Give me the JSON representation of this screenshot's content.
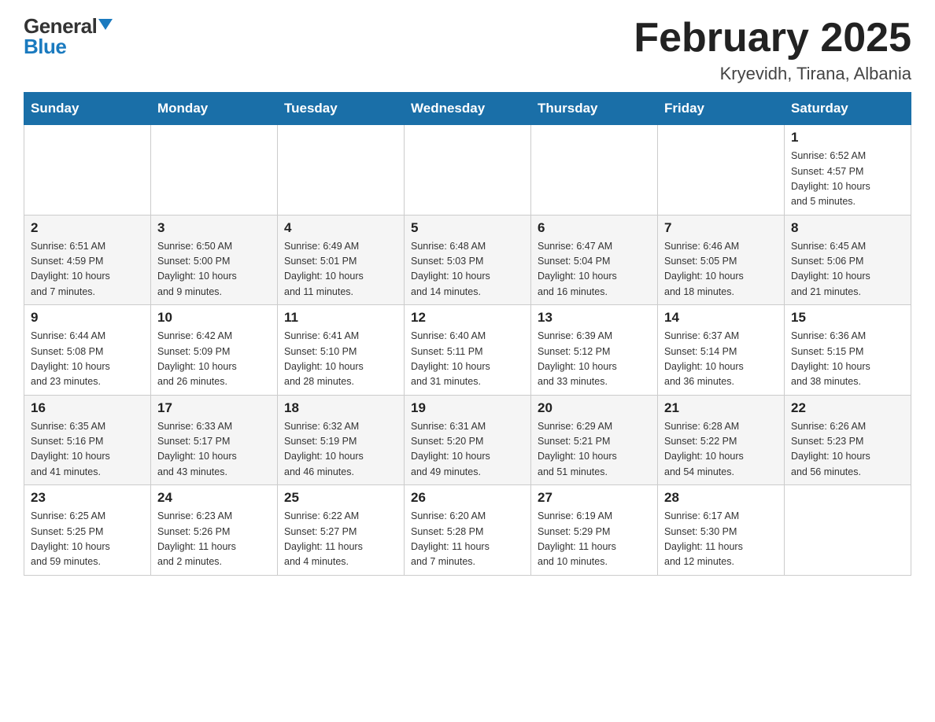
{
  "header": {
    "logo_general": "General",
    "logo_blue": "Blue",
    "title": "February 2025",
    "location": "Kryevidh, Tirana, Albania"
  },
  "weekdays": [
    "Sunday",
    "Monday",
    "Tuesday",
    "Wednesday",
    "Thursday",
    "Friday",
    "Saturday"
  ],
  "weeks": [
    [
      {
        "day": "",
        "info": ""
      },
      {
        "day": "",
        "info": ""
      },
      {
        "day": "",
        "info": ""
      },
      {
        "day": "",
        "info": ""
      },
      {
        "day": "",
        "info": ""
      },
      {
        "day": "",
        "info": ""
      },
      {
        "day": "1",
        "info": "Sunrise: 6:52 AM\nSunset: 4:57 PM\nDaylight: 10 hours\nand 5 minutes."
      }
    ],
    [
      {
        "day": "2",
        "info": "Sunrise: 6:51 AM\nSunset: 4:59 PM\nDaylight: 10 hours\nand 7 minutes."
      },
      {
        "day": "3",
        "info": "Sunrise: 6:50 AM\nSunset: 5:00 PM\nDaylight: 10 hours\nand 9 minutes."
      },
      {
        "day": "4",
        "info": "Sunrise: 6:49 AM\nSunset: 5:01 PM\nDaylight: 10 hours\nand 11 minutes."
      },
      {
        "day": "5",
        "info": "Sunrise: 6:48 AM\nSunset: 5:03 PM\nDaylight: 10 hours\nand 14 minutes."
      },
      {
        "day": "6",
        "info": "Sunrise: 6:47 AM\nSunset: 5:04 PM\nDaylight: 10 hours\nand 16 minutes."
      },
      {
        "day": "7",
        "info": "Sunrise: 6:46 AM\nSunset: 5:05 PM\nDaylight: 10 hours\nand 18 minutes."
      },
      {
        "day": "8",
        "info": "Sunrise: 6:45 AM\nSunset: 5:06 PM\nDaylight: 10 hours\nand 21 minutes."
      }
    ],
    [
      {
        "day": "9",
        "info": "Sunrise: 6:44 AM\nSunset: 5:08 PM\nDaylight: 10 hours\nand 23 minutes."
      },
      {
        "day": "10",
        "info": "Sunrise: 6:42 AM\nSunset: 5:09 PM\nDaylight: 10 hours\nand 26 minutes."
      },
      {
        "day": "11",
        "info": "Sunrise: 6:41 AM\nSunset: 5:10 PM\nDaylight: 10 hours\nand 28 minutes."
      },
      {
        "day": "12",
        "info": "Sunrise: 6:40 AM\nSunset: 5:11 PM\nDaylight: 10 hours\nand 31 minutes."
      },
      {
        "day": "13",
        "info": "Sunrise: 6:39 AM\nSunset: 5:12 PM\nDaylight: 10 hours\nand 33 minutes."
      },
      {
        "day": "14",
        "info": "Sunrise: 6:37 AM\nSunset: 5:14 PM\nDaylight: 10 hours\nand 36 minutes."
      },
      {
        "day": "15",
        "info": "Sunrise: 6:36 AM\nSunset: 5:15 PM\nDaylight: 10 hours\nand 38 minutes."
      }
    ],
    [
      {
        "day": "16",
        "info": "Sunrise: 6:35 AM\nSunset: 5:16 PM\nDaylight: 10 hours\nand 41 minutes."
      },
      {
        "day": "17",
        "info": "Sunrise: 6:33 AM\nSunset: 5:17 PM\nDaylight: 10 hours\nand 43 minutes."
      },
      {
        "day": "18",
        "info": "Sunrise: 6:32 AM\nSunset: 5:19 PM\nDaylight: 10 hours\nand 46 minutes."
      },
      {
        "day": "19",
        "info": "Sunrise: 6:31 AM\nSunset: 5:20 PM\nDaylight: 10 hours\nand 49 minutes."
      },
      {
        "day": "20",
        "info": "Sunrise: 6:29 AM\nSunset: 5:21 PM\nDaylight: 10 hours\nand 51 minutes."
      },
      {
        "day": "21",
        "info": "Sunrise: 6:28 AM\nSunset: 5:22 PM\nDaylight: 10 hours\nand 54 minutes."
      },
      {
        "day": "22",
        "info": "Sunrise: 6:26 AM\nSunset: 5:23 PM\nDaylight: 10 hours\nand 56 minutes."
      }
    ],
    [
      {
        "day": "23",
        "info": "Sunrise: 6:25 AM\nSunset: 5:25 PM\nDaylight: 10 hours\nand 59 minutes."
      },
      {
        "day": "24",
        "info": "Sunrise: 6:23 AM\nSunset: 5:26 PM\nDaylight: 11 hours\nand 2 minutes."
      },
      {
        "day": "25",
        "info": "Sunrise: 6:22 AM\nSunset: 5:27 PM\nDaylight: 11 hours\nand 4 minutes."
      },
      {
        "day": "26",
        "info": "Sunrise: 6:20 AM\nSunset: 5:28 PM\nDaylight: 11 hours\nand 7 minutes."
      },
      {
        "day": "27",
        "info": "Sunrise: 6:19 AM\nSunset: 5:29 PM\nDaylight: 11 hours\nand 10 minutes."
      },
      {
        "day": "28",
        "info": "Sunrise: 6:17 AM\nSunset: 5:30 PM\nDaylight: 11 hours\nand 12 minutes."
      },
      {
        "day": "",
        "info": ""
      }
    ]
  ]
}
